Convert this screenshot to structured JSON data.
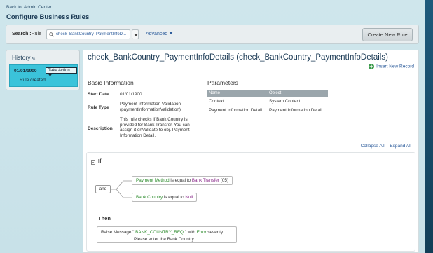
{
  "nav": {
    "back_link": "Back to: Admin Center"
  },
  "page_title": "Configure Business Rules",
  "search": {
    "label_prefix": "Search :",
    "label_type": "Rule",
    "value": "check_BankCountry_PaymentInfoD...",
    "advanced_label": "Advanced"
  },
  "toolbar": {
    "create_label": "Create New Rule"
  },
  "history": {
    "title": "History «",
    "entries": [
      {
        "date": "01/01/1900",
        "action_label": "Take Action",
        "note": "Rule created"
      }
    ]
  },
  "rule": {
    "title": "check_BankCountry_PaymentInfoDetails (check_BankCountry_PaymentInfoDetails)",
    "insert_record_label": "Insert New Record"
  },
  "basic_info": {
    "heading": "Basic Information",
    "start_date_label": "Start Date",
    "start_date": "01/01/1900",
    "rule_type_label": "Rule Type",
    "rule_type_line1": "Payment Information Validation",
    "rule_type_line2": "(paymentInformationValidation)",
    "description_label": "Description",
    "description_lines": [
      "This rule checks if Bank Country is",
      "provided for Bank Transfer. You can",
      "assign it onValidate to obj. Payment",
      "Information Detail."
    ]
  },
  "parameters": {
    "heading": "Parameters",
    "columns": [
      "Name",
      "Object"
    ],
    "rows": [
      [
        "Context",
        "System Context"
      ],
      [
        "Payment Information Detail",
        "Payment Information Detail"
      ]
    ]
  },
  "tree_controls": {
    "collapse_all": "Collapse All",
    "separator": "|",
    "expand_all": "Expand All"
  },
  "if_block": {
    "label": "If",
    "operator": "and",
    "conditions": [
      {
        "field": "Payment Method",
        "op": " is equal to ",
        "value": "Bank Transfer",
        "value_suffix": " (05)"
      },
      {
        "field": "Bank Country",
        "op": " is equal to ",
        "value": "Null",
        "value_suffix": ""
      }
    ]
  },
  "then_block": {
    "label": "Then",
    "action_prefix": "Raise Message  \"",
    "message_code": " BANK_COUNTRY_REQ ",
    "action_mid": "\" with ",
    "severity": "Error",
    "action_suffix": " severity",
    "message_text": "Please enter the Bank Country."
  },
  "colors": {
    "accent": "#2a5a9a",
    "history_card": "#3bc3da",
    "field_green": "#2a8a2a",
    "value_purple": "#8a2a8a",
    "right_strip": "#1e5a7c"
  }
}
